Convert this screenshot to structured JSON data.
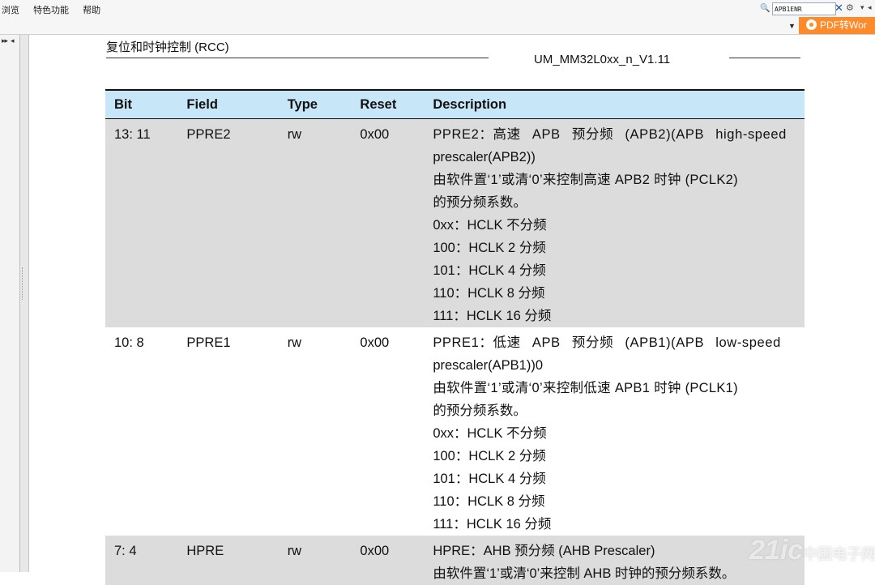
{
  "menu": {
    "items": [
      "浏览",
      "特色功能",
      "帮助"
    ]
  },
  "search": {
    "value": "APB1ENR"
  },
  "toolbar": {
    "pdf_label": "PDF转Wor"
  },
  "doc": {
    "section_title": "复位和时钟控制 (RCC)",
    "doc_id": "UM_MM32L0xx_n_V1.11"
  },
  "table": {
    "headers": {
      "bit": "Bit",
      "field": "Field",
      "type": "Type",
      "reset": "Reset",
      "desc": "Description"
    },
    "rows": [
      {
        "bit": "13: 11",
        "field": "PPRE2",
        "type": "rw",
        "reset": "0x00",
        "desc": [
          "PPRE2：高速 APB 预分频 (APB2)(APB high-speed",
          "prescaler(APB2))",
          "由软件置‘1’或清‘0’来控制高速 APB2 时钟 (PCLK2)",
          "的预分频系数。",
          "0xx：HCLK 不分频",
          "100：HCLK 2 分频",
          "101：HCLK 4 分频",
          "110：HCLK 8 分频",
          "111：HCLK 16 分频"
        ]
      },
      {
        "bit": "10: 8",
        "field": "PPRE1",
        "type": "rw",
        "reset": "0x00",
        "desc": [
          "PPRE1：低速 APB 预分频 (APB1)(APB low-speed",
          "prescaler(APB1))0",
          "由软件置‘1’或清‘0’来控制低速 APB1 时钟 (PCLK1)",
          "的预分频系数。",
          "0xx：HCLK 不分频",
          "100：HCLK 2 分频",
          "101：HCLK 4 分频",
          "110：HCLK 8 分频",
          "111：HCLK 16 分频"
        ]
      },
      {
        "bit": "7: 4",
        "field": "HPRE",
        "type": "rw",
        "reset": "0x00",
        "desc": [
          "HPRE：AHB 预分频 (AHB Prescaler)",
          "由软件置‘1’或清‘0’来控制 AHB 时钟的预分频系数。"
        ]
      }
    ]
  },
  "watermark": {
    "brand": "21ic",
    "cn": "中国电子网"
  }
}
